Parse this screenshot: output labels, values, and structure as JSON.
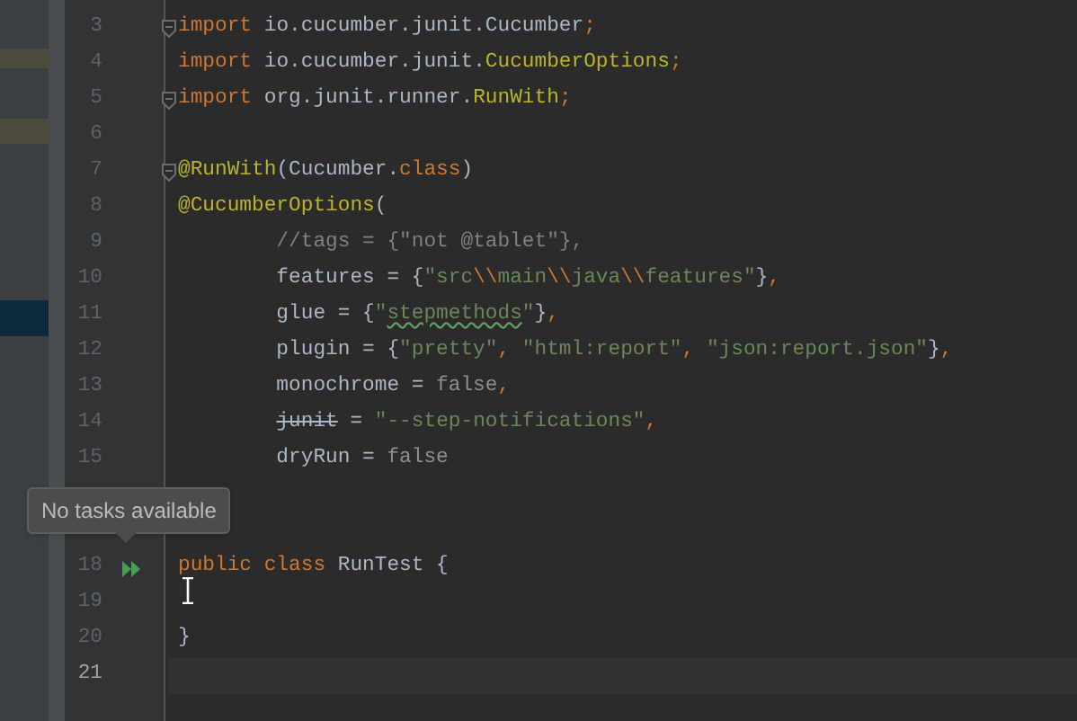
{
  "editor": {
    "lines": [
      {
        "number": "3",
        "fold": true,
        "tokens": [
          {
            "kind": "kw",
            "text": "import "
          },
          {
            "kind": "plain",
            "text": "io.cucumber.junit.Cucumber"
          },
          {
            "kind": "kw",
            "text": ";"
          }
        ]
      },
      {
        "number": "4",
        "tokens": [
          {
            "kind": "kw",
            "text": "import "
          },
          {
            "kind": "plain",
            "text": "io.cucumber.junit."
          },
          {
            "kind": "ann",
            "text": "CucumberOptions"
          },
          {
            "kind": "kw",
            "text": ";"
          }
        ]
      },
      {
        "number": "5",
        "fold": true,
        "tokens": [
          {
            "kind": "kw",
            "text": "import "
          },
          {
            "kind": "plain",
            "text": "org.junit.runner."
          },
          {
            "kind": "ann",
            "text": "RunWith"
          },
          {
            "kind": "kw",
            "text": ";"
          }
        ]
      },
      {
        "number": "6"
      },
      {
        "number": "7",
        "fold": true,
        "tokens": [
          {
            "kind": "ann",
            "text": "@RunWith"
          },
          {
            "kind": "plain",
            "text": "(Cucumber."
          },
          {
            "kind": "kw",
            "text": "class"
          },
          {
            "kind": "plain",
            "text": ")"
          }
        ]
      },
      {
        "number": "8",
        "tokens": [
          {
            "kind": "ann",
            "text": "@CucumberOptions"
          },
          {
            "kind": "plain",
            "text": "("
          }
        ]
      },
      {
        "number": "9",
        "tokens": [
          {
            "kind": "com",
            "text": "        //tags = {\"not @tablet\"},"
          }
        ]
      },
      {
        "number": "10",
        "tokens": [
          {
            "kind": "plain",
            "text": "        features = {"
          },
          {
            "kind": "str",
            "text": "\"src"
          },
          {
            "kind": "esc",
            "text": "\\\\"
          },
          {
            "kind": "str",
            "text": "main"
          },
          {
            "kind": "esc",
            "text": "\\\\"
          },
          {
            "kind": "str",
            "text": "java"
          },
          {
            "kind": "esc",
            "text": "\\\\"
          },
          {
            "kind": "str",
            "text": "features\""
          },
          {
            "kind": "plain",
            "text": "}"
          },
          {
            "kind": "kw",
            "text": ","
          }
        ]
      },
      {
        "number": "11",
        "tokens": [
          {
            "kind": "plain",
            "text": "        glue = {"
          },
          {
            "kind": "str",
            "text": "\""
          },
          {
            "kind": "typo",
            "text": "stepmethods"
          },
          {
            "kind": "str",
            "text": "\""
          },
          {
            "kind": "plain",
            "text": "}"
          },
          {
            "kind": "kw",
            "text": ","
          }
        ]
      },
      {
        "number": "12",
        "tokens": [
          {
            "kind": "plain",
            "text": "        plugin = {"
          },
          {
            "kind": "str",
            "text": "\"pretty\""
          },
          {
            "kind": "kw",
            "text": ", "
          },
          {
            "kind": "str",
            "text": "\"html:report\""
          },
          {
            "kind": "kw",
            "text": ", "
          },
          {
            "kind": "str",
            "text": "\"json:report.json\""
          },
          {
            "kind": "plain",
            "text": "}"
          },
          {
            "kind": "kw",
            "text": ","
          }
        ]
      },
      {
        "number": "13",
        "tokens": [
          {
            "kind": "plain",
            "text": "        monochrome = "
          },
          {
            "kind": "dim",
            "text": "false"
          },
          {
            "kind": "kw",
            "text": ","
          }
        ]
      },
      {
        "number": "14",
        "tokens": [
          {
            "kind": "deprecated",
            "text": "        junit"
          },
          {
            "kind": "plain",
            "text": " = "
          },
          {
            "kind": "str",
            "text": "\"--step-notifications\""
          },
          {
            "kind": "kw",
            "text": ","
          }
        ]
      },
      {
        "number": "15",
        "tokens": [
          {
            "kind": "plain",
            "text": "        dryRun = "
          },
          {
            "kind": "dim",
            "text": "false"
          }
        ]
      },
      {
        "number": "18",
        "run_icon": true,
        "tokens": [
          {
            "kind": "kw",
            "text": "public class "
          },
          {
            "kind": "plain",
            "text": "RunTest {"
          }
        ]
      },
      {
        "number": "19"
      },
      {
        "number": "20",
        "tokens": [
          {
            "kind": "plain",
            "text": "}"
          }
        ]
      },
      {
        "number": "21",
        "current": true
      }
    ]
  },
  "tooltip": {
    "text": "No tasks available"
  }
}
